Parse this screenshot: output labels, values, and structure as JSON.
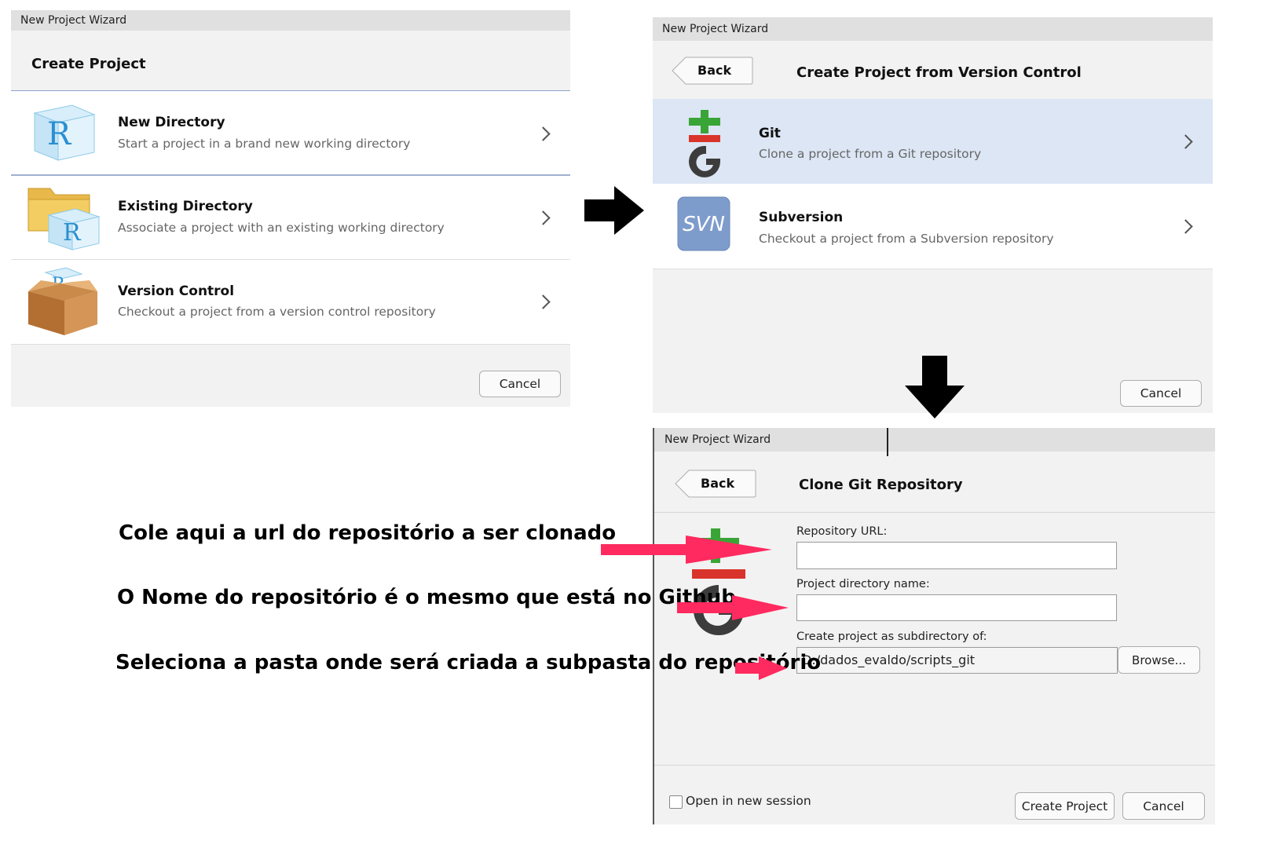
{
  "colors": {
    "selected_row": "#dce6f4",
    "annotation_arrow": "#ff2a5f",
    "panel_bg": "#f2f2f2",
    "titlebar_bg": "#e0e0e0"
  },
  "panel1": {
    "window_title": "New Project Wizard",
    "header": "Create Project",
    "items": [
      {
        "title": "New Directory",
        "subtitle": "Start a project in a brand new working directory",
        "icon": "r-cube-icon"
      },
      {
        "title": "Existing Directory",
        "subtitle": "Associate a project with an existing working directory",
        "icon": "folder-r-icon"
      },
      {
        "title": "Version Control",
        "subtitle": "Checkout a project from a version control repository",
        "icon": "box-r-icon"
      }
    ],
    "cancel_label": "Cancel"
  },
  "panel2": {
    "window_title": "New Project Wizard",
    "back_label": "Back",
    "header": "Create Project from Version Control",
    "items": [
      {
        "title": "Git",
        "subtitle": "Clone a project from a Git repository",
        "icon": "git-icon",
        "selected": true
      },
      {
        "title": "Subversion",
        "subtitle": "Checkout a project from a Subversion repository",
        "icon": "svn-icon",
        "selected": false
      }
    ],
    "svn_icon_text": "SVN",
    "cancel_label": "Cancel"
  },
  "panel3": {
    "window_title": "New Project Wizard",
    "back_label": "Back",
    "header": "Clone Git Repository",
    "repo_url_label": "Repository URL:",
    "repo_url_value": "",
    "dir_name_label": "Project directory name:",
    "dir_name_value": "",
    "subdir_label": "Create project as subdirectory of:",
    "subdir_value": "D:/dados_evaldo/scripts_git",
    "browse_label": "Browse...",
    "open_new_session_label": "Open in new session",
    "open_new_session_checked": false,
    "create_label": "Create Project",
    "cancel_label": "Cancel"
  },
  "annotations": [
    "Cole aqui a url do repositório a ser clonado",
    "O Nome do repositório é o mesmo que está no Github",
    "Seleciona a pasta onde será criada a subpasta do repositório"
  ]
}
